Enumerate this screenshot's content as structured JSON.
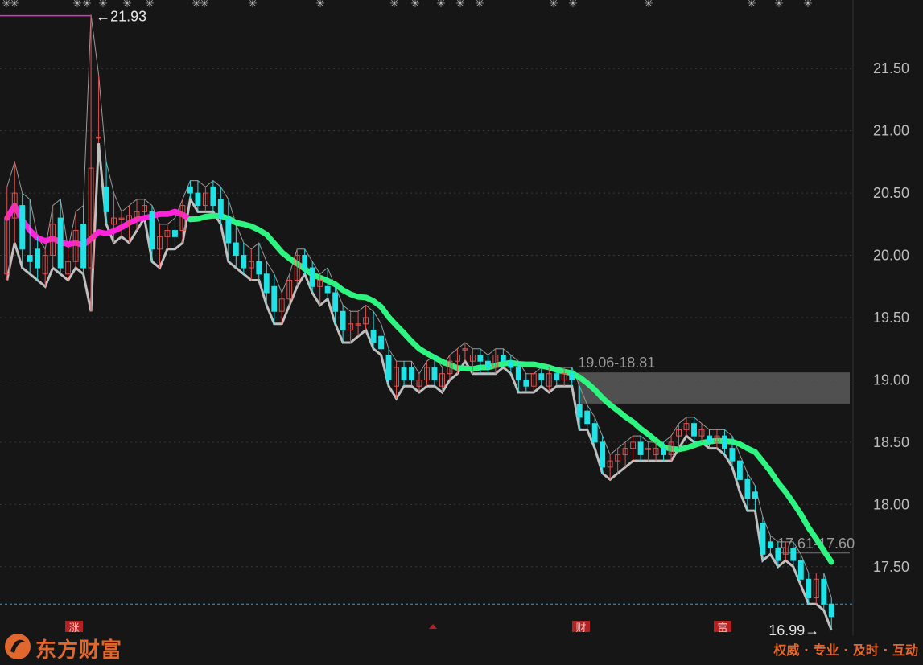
{
  "chart_data": {
    "type": "candlestick",
    "y_axis": {
      "position": "right",
      "range": [
        16.95,
        22.05
      ],
      "ticks": [
        17.5,
        18.0,
        18.5,
        19.0,
        19.5,
        20.0,
        20.5,
        21.0,
        21.5
      ],
      "tick_labels": [
        "17.50",
        "18.00",
        "18.50",
        "19.00",
        "19.50",
        "20.00",
        "20.50",
        "21.00",
        "21.50"
      ]
    },
    "grid": true,
    "colors": {
      "up": "#e05050",
      "down": "#1fe3e6",
      "ma": "#2ef57f",
      "ma_early": "#ff22dd",
      "envelope": "#bfbfbf",
      "zone": "#5a5a5a",
      "last_price": "#2f9fd8",
      "marker": "#b32222"
    },
    "candles": [
      [
        19.85,
        20.55,
        19.8,
        20.3
      ],
      [
        20.3,
        20.75,
        20.1,
        20.5
      ],
      [
        20.4,
        20.5,
        19.9,
        20.05
      ],
      [
        20.0,
        20.45,
        19.85,
        19.95
      ],
      [
        20.05,
        20.15,
        19.8,
        19.9
      ],
      [
        19.85,
        20.05,
        19.75,
        20.0
      ],
      [
        20.0,
        20.4,
        19.9,
        20.25
      ],
      [
        20.3,
        20.45,
        19.85,
        19.9
      ],
      [
        19.85,
        20.05,
        19.8,
        19.95
      ],
      [
        19.95,
        20.35,
        19.9,
        20.2
      ],
      [
        20.25,
        20.4,
        19.85,
        19.9
      ],
      [
        19.9,
        21.93,
        19.55,
        20.7
      ],
      [
        20.95,
        21.45,
        20.9,
        20.95
      ],
      [
        20.55,
        20.75,
        20.25,
        20.35
      ],
      [
        20.25,
        20.5,
        20.1,
        20.3
      ],
      [
        20.3,
        20.35,
        20.15,
        20.3
      ],
      [
        20.25,
        20.4,
        20.1,
        20.32
      ],
      [
        20.3,
        20.45,
        20.2,
        20.35
      ],
      [
        20.35,
        20.45,
        20.3,
        20.4
      ],
      [
        20.35,
        20.4,
        19.95,
        20.05
      ],
      [
        20.05,
        20.25,
        19.9,
        20.15
      ],
      [
        20.15,
        20.25,
        20.05,
        20.2
      ],
      [
        20.2,
        20.3,
        20.05,
        20.15
      ],
      [
        20.2,
        20.45,
        20.1,
        20.4
      ],
      [
        20.55,
        20.6,
        20.45,
        20.5
      ],
      [
        20.5,
        20.6,
        20.35,
        20.4
      ],
      [
        20.4,
        20.55,
        20.35,
        20.5
      ],
      [
        20.55,
        20.6,
        20.35,
        20.4
      ],
      [
        20.45,
        20.55,
        20.25,
        20.3
      ],
      [
        20.3,
        20.45,
        19.95,
        20.1
      ],
      [
        20.1,
        20.25,
        19.9,
        20.0
      ],
      [
        20.0,
        20.1,
        19.85,
        19.9
      ],
      [
        19.9,
        20.05,
        19.8,
        19.95
      ],
      [
        19.95,
        20.1,
        19.8,
        19.85
      ],
      [
        19.85,
        19.95,
        19.6,
        19.7
      ],
      [
        19.75,
        19.85,
        19.45,
        19.55
      ],
      [
        19.55,
        19.7,
        19.45,
        19.65
      ],
      [
        19.65,
        19.85,
        19.6,
        19.8
      ],
      [
        19.8,
        20.05,
        19.75,
        20.0
      ],
      [
        20.0,
        20.05,
        19.85,
        19.9
      ],
      [
        19.9,
        19.95,
        19.7,
        19.75
      ],
      [
        19.75,
        19.85,
        19.6,
        19.8
      ],
      [
        19.75,
        19.9,
        19.65,
        19.7
      ],
      [
        19.7,
        19.75,
        19.45,
        19.55
      ],
      [
        19.55,
        19.6,
        19.3,
        19.4
      ],
      [
        19.4,
        19.55,
        19.3,
        19.45
      ],
      [
        19.45,
        19.55,
        19.35,
        19.45
      ],
      [
        19.45,
        19.6,
        19.4,
        19.5
      ],
      [
        19.4,
        19.55,
        19.25,
        19.3
      ],
      [
        19.35,
        19.45,
        19.2,
        19.25
      ],
      [
        19.2,
        19.25,
        18.95,
        19.0
      ],
      [
        18.95,
        19.15,
        18.85,
        19.1
      ],
      [
        19.1,
        19.15,
        18.95,
        19.0
      ],
      [
        19.1,
        19.15,
        18.95,
        19.0
      ],
      [
        18.95,
        19.05,
        18.9,
        19.0
      ],
      [
        19.0,
        19.15,
        18.95,
        19.1
      ],
      [
        19.1,
        19.2,
        18.95,
        19.0
      ],
      [
        18.95,
        19.1,
        18.9,
        19.05
      ],
      [
        19.05,
        19.2,
        19.0,
        19.15
      ],
      [
        19.15,
        19.25,
        19.05,
        19.2
      ],
      [
        19.25,
        19.3,
        19.15,
        19.25
      ],
      [
        19.15,
        19.25,
        19.05,
        19.2
      ],
      [
        19.2,
        19.25,
        19.05,
        19.15
      ],
      [
        19.15,
        19.2,
        19.05,
        19.1
      ],
      [
        19.1,
        19.25,
        19.05,
        19.2
      ],
      [
        19.2,
        19.25,
        19.1,
        19.15
      ],
      [
        19.15,
        19.2,
        19.05,
        19.1
      ],
      [
        19.1,
        19.15,
        18.9,
        19.0
      ],
      [
        19.0,
        19.05,
        18.9,
        18.95
      ],
      [
        18.95,
        19.05,
        18.9,
        19.05
      ],
      [
        19.05,
        19.1,
        18.95,
        19.0
      ],
      [
        18.95,
        19.1,
        18.9,
        19.05
      ],
      [
        19.05,
        19.1,
        18.95,
        19.0
      ],
      [
        19.0,
        19.1,
        18.95,
        19.05
      ],
      [
        19.05,
        19.1,
        18.95,
        19.0
      ],
      [
        18.8,
        18.95,
        18.6,
        18.7
      ],
      [
        18.75,
        18.8,
        18.6,
        18.65
      ],
      [
        18.65,
        18.7,
        18.45,
        18.5
      ],
      [
        18.5,
        18.55,
        18.25,
        18.3
      ],
      [
        18.3,
        18.4,
        18.2,
        18.35
      ],
      [
        18.35,
        18.45,
        18.25,
        18.4
      ],
      [
        18.4,
        18.5,
        18.3,
        18.45
      ],
      [
        18.45,
        18.55,
        18.35,
        18.5
      ],
      [
        18.5,
        18.55,
        18.35,
        18.4
      ],
      [
        18.45,
        18.5,
        18.35,
        18.45
      ],
      [
        18.4,
        18.5,
        18.35,
        18.45
      ],
      [
        18.45,
        18.5,
        18.35,
        18.4
      ],
      [
        18.4,
        18.55,
        18.35,
        18.5
      ],
      [
        18.55,
        18.65,
        18.45,
        18.6
      ],
      [
        18.6,
        18.7,
        18.55,
        18.65
      ],
      [
        18.65,
        18.7,
        18.5,
        18.55
      ],
      [
        18.55,
        18.65,
        18.5,
        18.6
      ],
      [
        18.55,
        18.6,
        18.45,
        18.5
      ],
      [
        18.5,
        18.6,
        18.45,
        18.55
      ],
      [
        18.55,
        18.6,
        18.4,
        18.45
      ],
      [
        18.45,
        18.55,
        18.3,
        18.35
      ],
      [
        18.35,
        18.4,
        18.1,
        18.2
      ],
      [
        18.2,
        18.25,
        17.95,
        18.05
      ],
      [
        18.1,
        18.15,
        17.95,
        18.05
      ],
      [
        17.85,
        17.9,
        17.55,
        17.6
      ],
      [
        17.7,
        17.75,
        17.6,
        17.65
      ],
      [
        17.65,
        17.7,
        17.5,
        17.55
      ],
      [
        17.6,
        17.7,
        17.55,
        17.65
      ],
      [
        17.65,
        17.7,
        17.5,
        17.55
      ],
      [
        17.55,
        17.6,
        17.35,
        17.4
      ],
      [
        17.4,
        17.45,
        17.2,
        17.25
      ],
      [
        17.25,
        17.45,
        17.2,
        17.4
      ],
      [
        17.4,
        17.45,
        17.15,
        17.2
      ],
      [
        17.2,
        17.25,
        16.99,
        17.1
      ]
    ],
    "annotations": {
      "high": "21.93",
      "low": "16.99",
      "zone_upper_label": "19.06-18.81",
      "zone_upper": [
        18.81,
        19.06
      ],
      "zone_lower_label": "17.61-17.60",
      "zone_lower": [
        17.6,
        17.61
      ],
      "last_price": 17.2
    },
    "bottom_markers": [
      "涨",
      "财",
      "富"
    ]
  },
  "watermark": {
    "brand": "东方财富",
    "slogan": "权威 · 专业 · 及时 · 互动"
  }
}
